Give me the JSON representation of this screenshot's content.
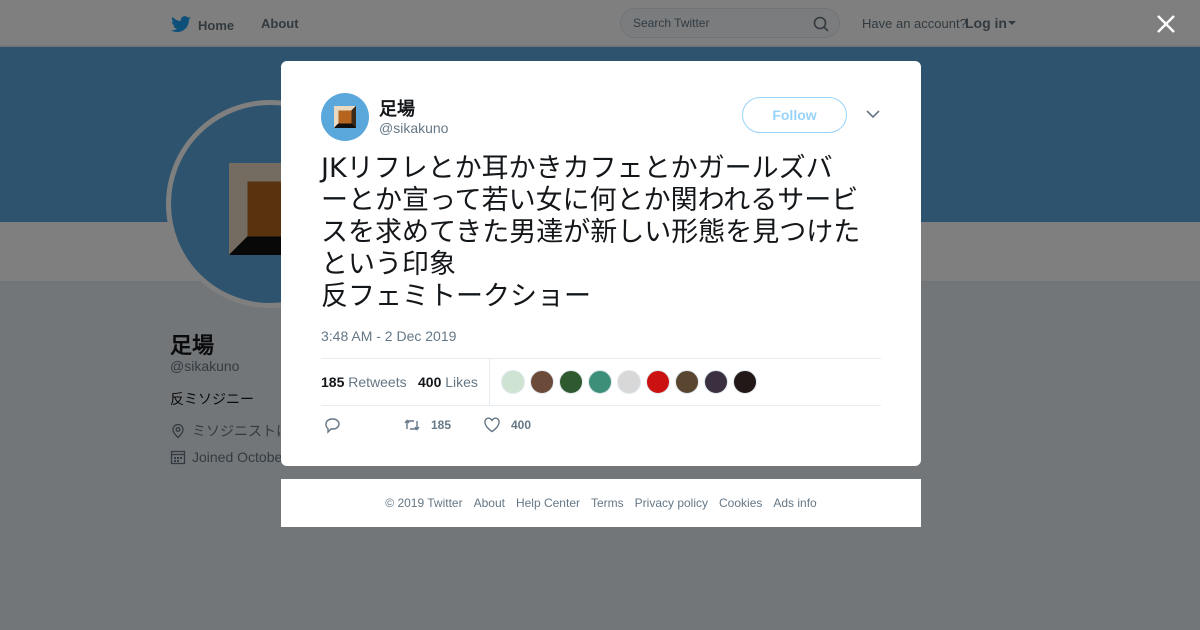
{
  "nav": {
    "home_label": "Home",
    "about_label": "About",
    "search_placeholder": "Search Twitter",
    "account_prompt": "Have an account?",
    "login_label": "Log in"
  },
  "profile": {
    "name": "足場",
    "handle": "@sikakuno",
    "bio": "反ミソジニー",
    "location": "ミソジニストに",
    "joined": "Joined Octobe"
  },
  "tweet": {
    "author_name": "足場",
    "author_handle": "@sikakuno",
    "follow_label": "Follow",
    "text_lines": [
      "JKリフレとか耳かきカフェとかガールズバ",
      "ーとか宣って若い女に何とか関われるサービ",
      "スを求めてきた男達が新しい形態を見つけた",
      "という印象",
      "反フェミトークショー"
    ],
    "timestamp": "3:48 AM - 2 Dec 2019",
    "retweets_count": "185",
    "retweets_label": "Retweets",
    "likes_count": "400",
    "likes_label": "Likes",
    "action_retweet_count": "185",
    "action_like_count": "400",
    "liker_avatar_colors": [
      "#cfe3d2",
      "#6b4a3a",
      "#2f5a2f",
      "#3d8f7a",
      "#d8d8d8",
      "#cc1111",
      "#5a4630",
      "#3a3040",
      "#221818"
    ]
  },
  "footer": {
    "links": [
      "© 2019 Twitter",
      "About",
      "Help Center",
      "Terms",
      "Privacy policy",
      "Cookies",
      "Ads info"
    ]
  },
  "colors": {
    "brand": "#1da1f2",
    "banner": "#5aa7dc",
    "avatar_bg": "#5aa7dc",
    "tile_brown": "#b5651d"
  }
}
